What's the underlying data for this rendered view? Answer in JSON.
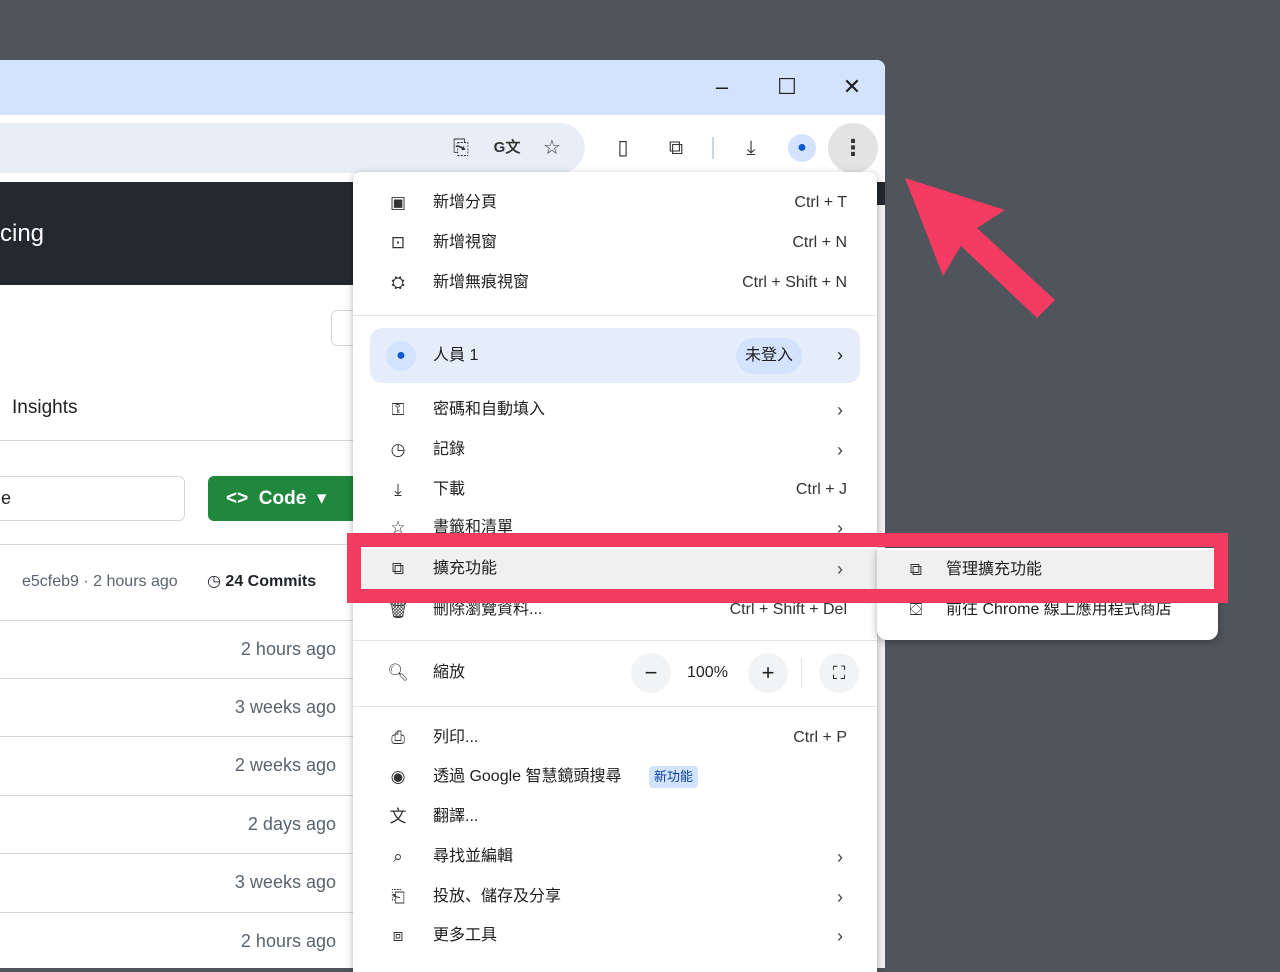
{
  "window": {
    "minimize": "–",
    "maximize": "☐",
    "close": "✕"
  },
  "toolbar": {
    "icons": [
      "install-app-icon",
      "translate-icon",
      "bookmark-star-icon",
      "mouse-extension-icon",
      "extensions-icon",
      "download-icon",
      "profile-icon",
      "more-menu-icon"
    ]
  },
  "page": {
    "header_text": "cing",
    "tab_insights": "Insights",
    "search_value": "e",
    "code_button": "Code",
    "commit_hash": "e5cfeb9 · 2 hours ago",
    "commits": "24 Commits",
    "times": [
      "2 hours ago",
      "3 weeks ago",
      "2 weeks ago",
      "2 days ago",
      "3 weeks ago",
      "2 hours ago"
    ]
  },
  "menu": {
    "new_tab": {
      "label": "新增分頁",
      "shortcut": "Ctrl + T"
    },
    "new_window": {
      "label": "新增視窗",
      "shortcut": "Ctrl + N"
    },
    "incognito": {
      "label": "新增無痕視窗",
      "shortcut": "Ctrl + Shift + N"
    },
    "profile": {
      "label": "人員 1",
      "badge": "未登入"
    },
    "passwords": {
      "label": "密碼和自動填入"
    },
    "history": {
      "label": "記錄"
    },
    "downloads": {
      "label": "下載",
      "shortcut": "Ctrl + J"
    },
    "bookmarks": {
      "label": "書籤和清單"
    },
    "extensions": {
      "label": "擴充功能"
    },
    "clear_data": {
      "label": "刪除瀏覽資料...",
      "shortcut": "Ctrl + Shift + Del"
    },
    "zoom": {
      "label": "縮放",
      "minus": "−",
      "value": "100%",
      "plus": "+"
    },
    "print": {
      "label": "列印...",
      "shortcut": "Ctrl + P"
    },
    "lens": {
      "label": "透過 Google 智慧鏡頭搜尋",
      "badge": "新功能"
    },
    "translate": {
      "label": "翻譯..."
    },
    "find": {
      "label": "尋找並編輯"
    },
    "cast": {
      "label": "投放、儲存及分享"
    },
    "more_tools": {
      "label": "更多工具"
    }
  },
  "submenu": {
    "manage": "管理擴充功能",
    "webstore": "前往 Chrome 線上應用程式商店"
  },
  "colors": {
    "highlight": "#f43b61",
    "arrow": "#f43b61",
    "code_green": "#1f883d",
    "titlebar": "#d3e3fd"
  }
}
